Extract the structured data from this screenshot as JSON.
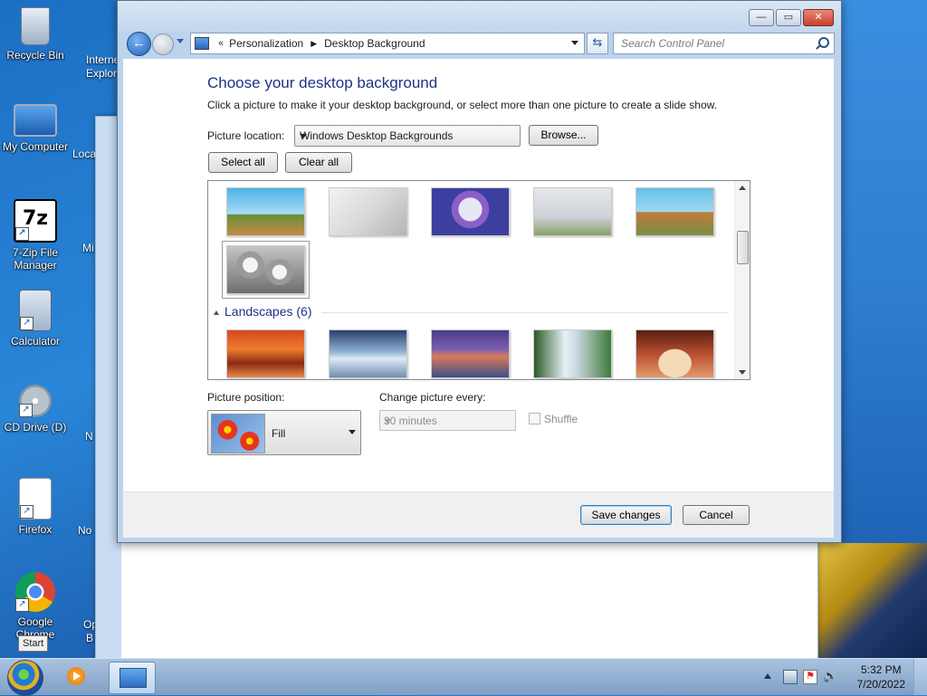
{
  "desktop": {
    "icons": [
      {
        "label": "Recycle Bin",
        "icon": "recycle-bin-icon"
      },
      {
        "label": "My Computer",
        "icon": "computer-icon"
      },
      {
        "label": "7-Zip File Manager",
        "icon": "7zip-icon"
      },
      {
        "label": "Calculator",
        "icon": "calculator-icon"
      },
      {
        "label": "CD Drive (D)",
        "icon": "cd-drive-icon"
      },
      {
        "label": "Firefox",
        "icon": "firefox-icon"
      },
      {
        "label": "Google Chrome",
        "icon": "chrome-icon"
      }
    ],
    "partial_labels": [
      "Interne",
      "Explor",
      "Loca",
      "Mi",
      "N",
      "No",
      "Op",
      "B"
    ]
  },
  "window": {
    "breadcrumb_prefix": "«",
    "breadcrumb": [
      "Personalization",
      "Desktop Background"
    ],
    "search_placeholder": "Search Control Panel",
    "caption": {
      "minimize": "—",
      "maximize": "▭",
      "close": "✕"
    }
  },
  "content": {
    "title": "Choose your desktop background",
    "subtitle": "Click a picture to make it your desktop background, or select more than one picture to create a slide show.",
    "picture_location_label": "Picture location:",
    "picture_location_value": "Windows Desktop Backgrounds",
    "browse_label": "Browse...",
    "select_all_label": "Select all",
    "clear_all_label": "Clear all",
    "gallery": {
      "group_title": "Landscapes (6)",
      "colors": {
        "row1": [
          "#4bb3e6",
          "#d9d9d9",
          "#3c3fa0",
          "#cfd2d8",
          "#65c0e8"
        ],
        "selected": "#8b8b8b",
        "row2": [
          "#d24a1d",
          "#8fb0d4",
          "#7b5fb0",
          "#3e7a3a",
          "#b84f30"
        ]
      }
    },
    "picture_position_label": "Picture position:",
    "picture_position_value": "Fill",
    "change_every_label": "Change picture every:",
    "change_every_value": "30 minutes",
    "shuffle_label": "Shuffle"
  },
  "footer": {
    "save_label": "Save changes",
    "cancel_label": "Cancel"
  },
  "taskbar": {
    "start_tooltip": "Start",
    "time": "5:32 PM",
    "date": "7/20/2022"
  }
}
